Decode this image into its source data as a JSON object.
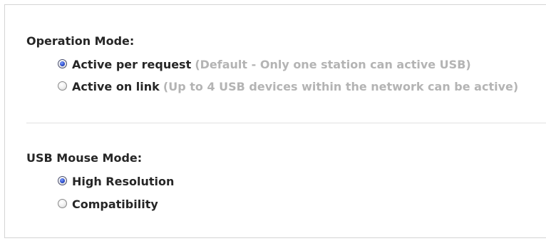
{
  "operation_mode": {
    "title": "Operation Mode:",
    "options": [
      {
        "label": "Active per request",
        "note": "(Default - Only one station can active USB)",
        "selected": true
      },
      {
        "label": "Active on link",
        "note": "(Up to 4 USB devices within the network can be active)",
        "selected": false
      }
    ]
  },
  "usb_mouse_mode": {
    "title": "USB Mouse Mode:",
    "options": [
      {
        "label": "High Resolution",
        "selected": true
      },
      {
        "label": "Compatibility",
        "selected": false
      }
    ]
  },
  "icons": {
    "radio_selected": "radio-selected-icon",
    "radio_unselected": "radio-unselected-icon"
  },
  "colors": {
    "text": "#262626",
    "note": "#b4b4b4",
    "radio_dot": "#2848c8",
    "divider": "#e2e2e2",
    "border": "#d4d4d4"
  }
}
